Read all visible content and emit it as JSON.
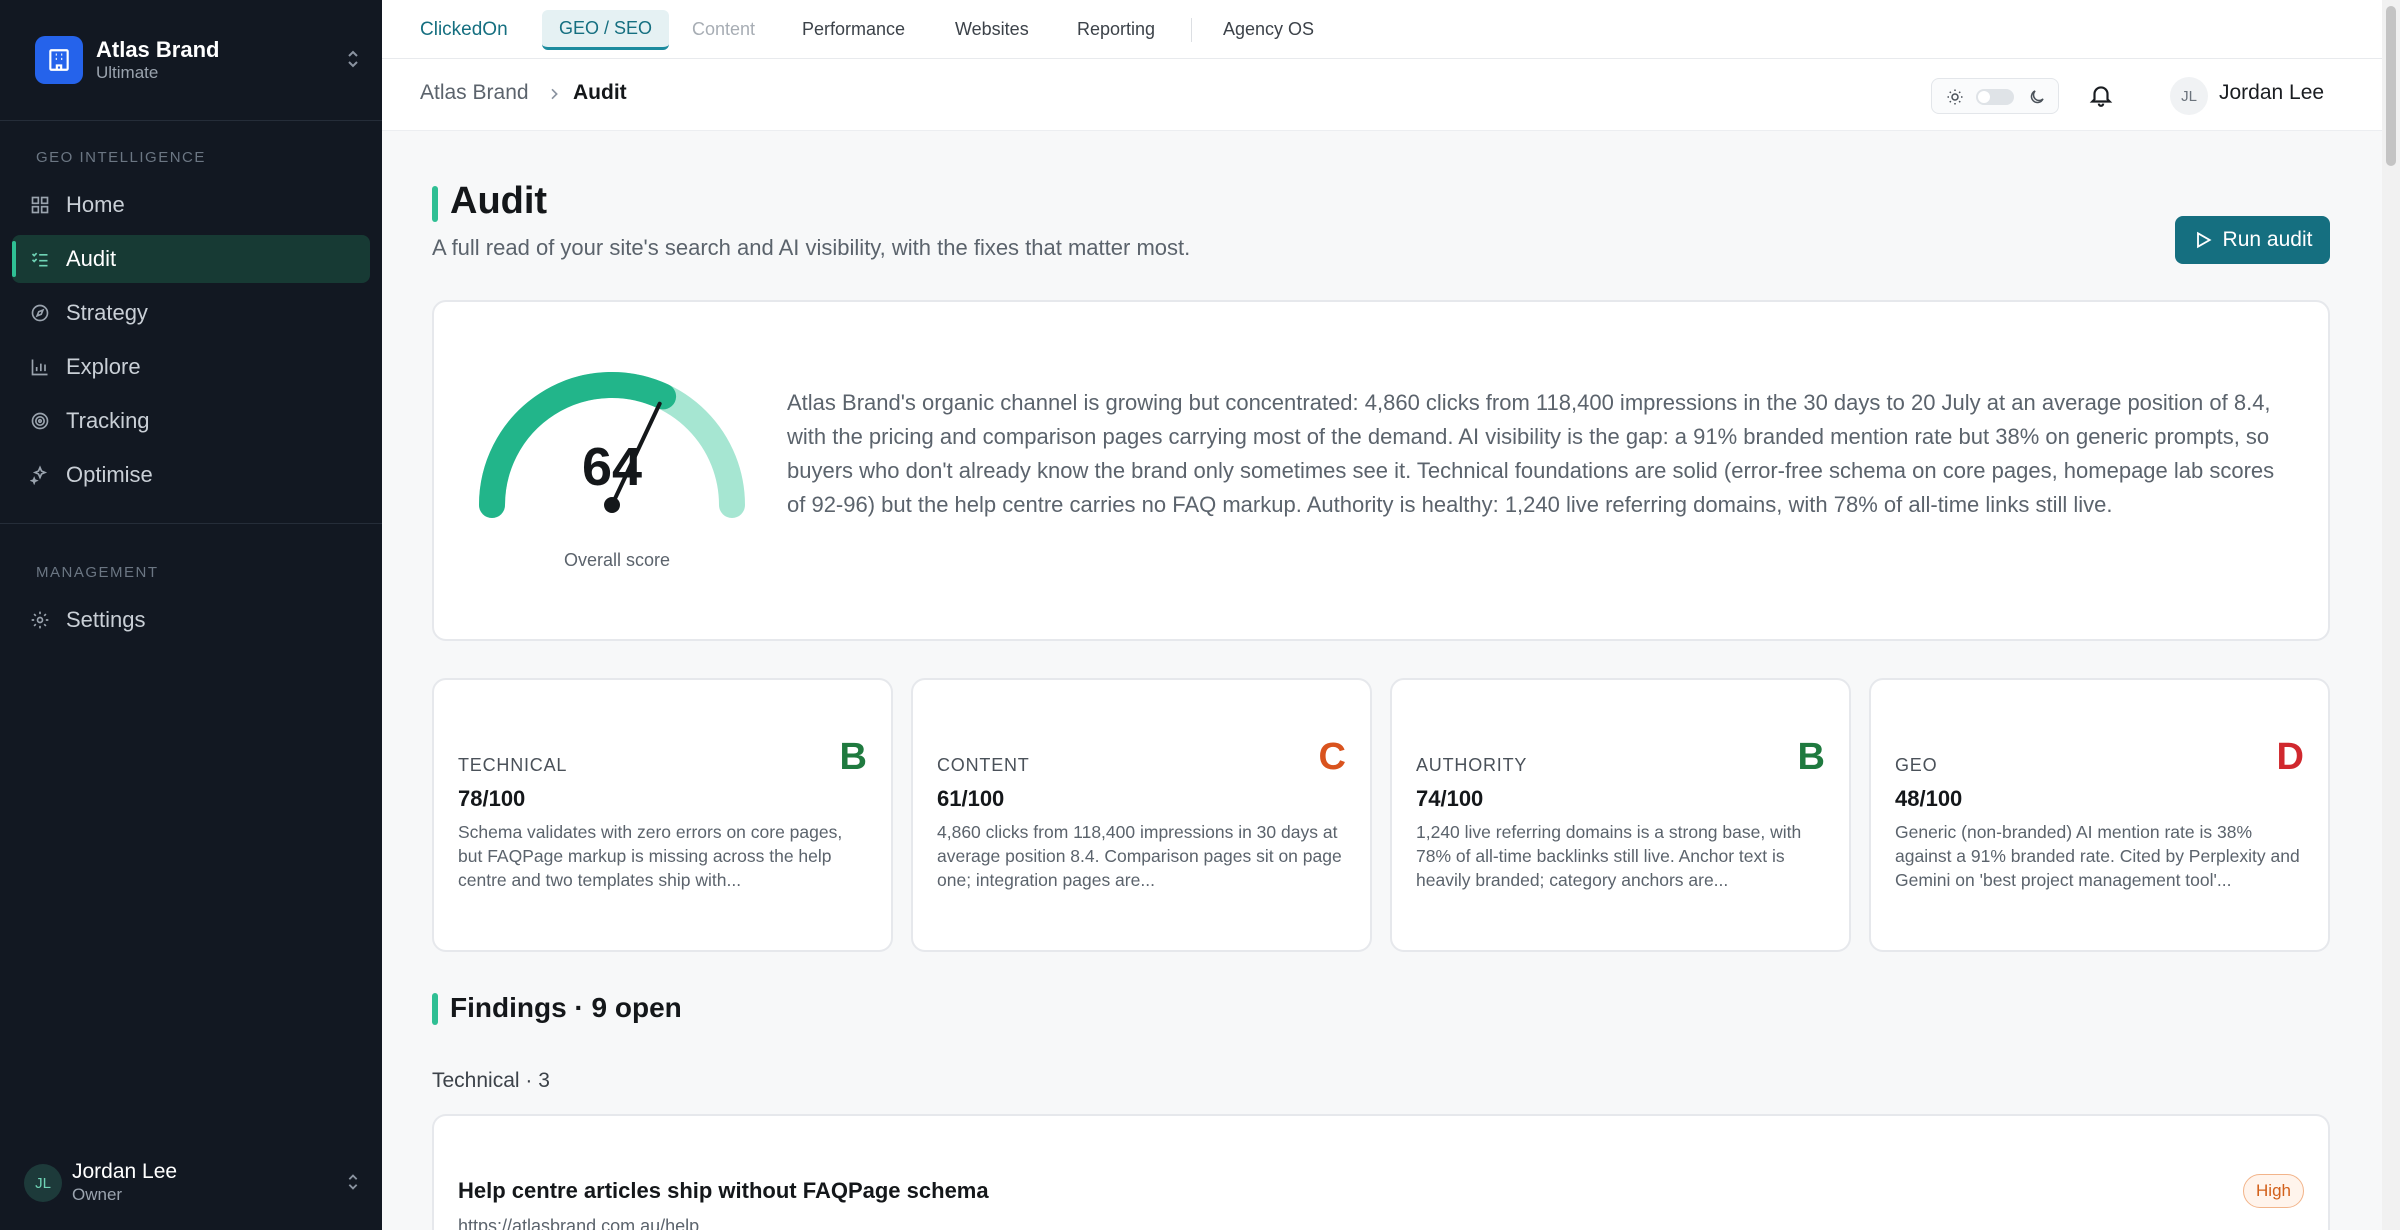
{
  "app": {
    "brand_name": "Atlas Brand",
    "brand_plan": "Ultimate"
  },
  "sidebar": {
    "section_geo": "GEO INTELLIGENCE",
    "section_management": "MANAGEMENT",
    "items": [
      {
        "label": "Home",
        "icon": "grid-icon"
      },
      {
        "label": "Audit",
        "icon": "checklist-icon",
        "active": true
      },
      {
        "label": "Strategy",
        "icon": "compass-icon"
      },
      {
        "label": "Explore",
        "icon": "bar-chart-icon"
      },
      {
        "label": "Tracking",
        "icon": "target-icon"
      },
      {
        "label": "Optimise",
        "icon": "sparkles-icon"
      }
    ],
    "settings_label": "Settings",
    "user": {
      "initials": "JL",
      "name": "Jordan Lee",
      "role": "Owner"
    }
  },
  "topnav": {
    "brand": "ClickedOn",
    "tabs": [
      "GEO / SEO",
      "Content",
      "Performance",
      "Websites",
      "Reporting",
      "Agency OS"
    ],
    "active_tab": "GEO / SEO"
  },
  "breadcrumb": {
    "parent": "Atlas Brand",
    "current": "Audit"
  },
  "header_user": {
    "initials": "JL",
    "name": "Jordan Lee"
  },
  "page": {
    "title": "Audit",
    "subtitle": "A full read of your site's search and AI visibility, with the fixes that matter most.",
    "run_button": "Run audit"
  },
  "summary": {
    "score": "64",
    "score_value": 64,
    "score_label": "Overall score",
    "text": "Atlas Brand's organic channel is growing but concentrated: 4,860 clicks from 118,400 impressions in the 30 days to 20 July at an average position of 8.4, with the pricing and comparison pages carrying most of the demand. AI visibility is the gap: a 91% branded mention rate but 38% on generic prompts, so buyers who don't already know the brand only sometimes see it. Technical foundations are solid (error-free schema on core pages, homepage lab scores of 92-96) but the help centre carries no FAQ markup. Authority is healthy: 1,240 live referring domains, with 78% of all-time links still live.",
    "colors": {
      "filled": "#22b58a",
      "remaining": "#a6e6d2"
    }
  },
  "scores": [
    {
      "label": "TECHNICAL",
      "grade": "B",
      "score": "78/100",
      "color": "#1f7a3f",
      "text": "Schema validates with zero errors on core pages, but FAQPage markup is missing across the help centre and two templates ship with..."
    },
    {
      "label": "CONTENT",
      "grade": "C",
      "score": "61/100",
      "color": "#d9531e",
      "text": "4,860 clicks from 118,400 impressions in 30 days at average position 8.4. Comparison pages sit on page one; integration pages are..."
    },
    {
      "label": "AUTHORITY",
      "grade": "B",
      "score": "74/100",
      "color": "#1f7a3f",
      "text": "1,240 live referring domains is a strong base, with 78% of all-time backlinks still live. Anchor text is heavily branded; category anchors are..."
    },
    {
      "label": "GEO",
      "grade": "D",
      "score": "48/100",
      "color": "#d0282e",
      "text": "Generic (non-branded) AI mention rate is 38% against a 91% branded rate. Cited by Perplexity and Gemini on 'best project management tool'..."
    }
  ],
  "findings": {
    "title": "Findings · 9 open",
    "group": "Technical · 3",
    "items": [
      {
        "title": "Help centre articles ship without FAQPage schema",
        "url": "https://atlasbrand.com.au/help",
        "severity": "High"
      }
    ]
  },
  "accent_color": "#156f80"
}
